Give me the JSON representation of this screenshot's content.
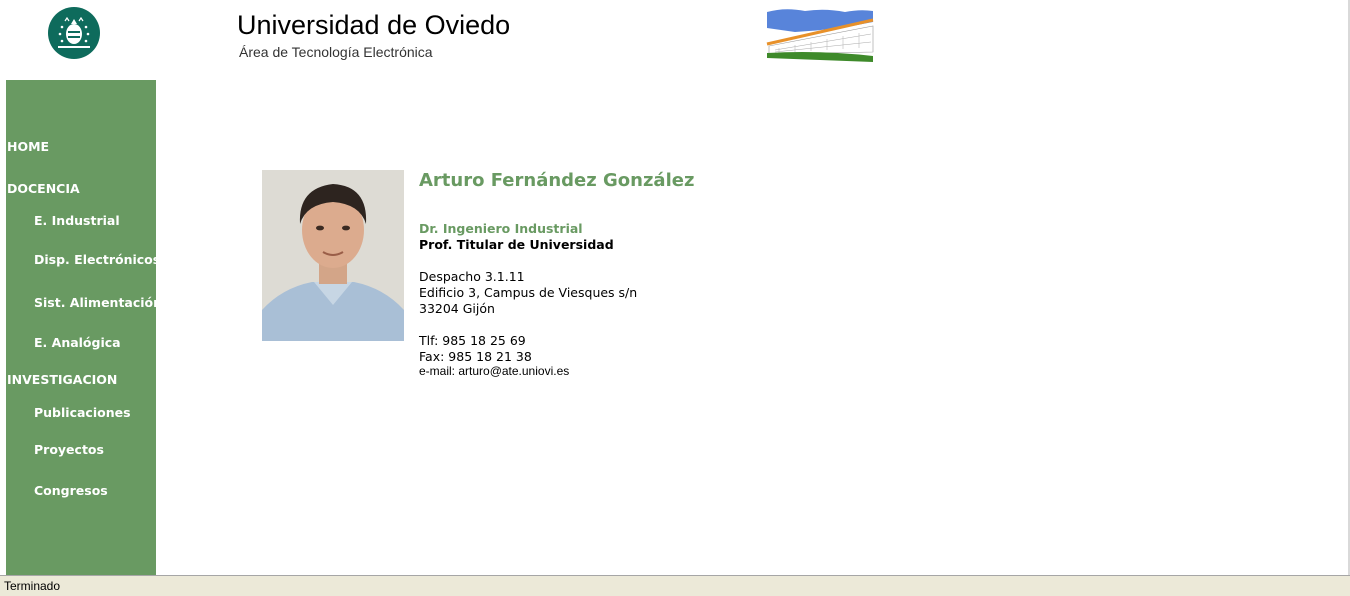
{
  "header": {
    "title": "Universidad de Oviedo",
    "subtitle": "Área de Tecnología Electrónica"
  },
  "sidebar": {
    "items": [
      {
        "label": "HOME",
        "level": "top"
      },
      {
        "label": "DOCENCIA",
        "level": "top"
      },
      {
        "label": "E. Industrial",
        "level": "sub"
      },
      {
        "label": "Disp. Electrónicos",
        "level": "sub"
      },
      {
        "label": "Sist. Alimentación",
        "level": "sub"
      },
      {
        "label": "E. Analógica",
        "level": "sub"
      },
      {
        "label": "INVESTIGACION",
        "level": "top"
      },
      {
        "label": "Publicaciones",
        "level": "sub"
      },
      {
        "label": "Proyectos",
        "level": "sub"
      },
      {
        "label": "Congresos",
        "level": "sub"
      }
    ]
  },
  "profile": {
    "name": "Arturo Fernández González",
    "degree": "Dr. Ingeniero Industrial",
    "position": "Prof. Titular de Universidad",
    "office": "Despacho 3.1.11",
    "building": "Edificio 3, Campus de Viesques s/n",
    "city": "33204 Gijón",
    "phone": "Tlf: 985 18 25 69",
    "fax": "Fax: 985 18 21 38",
    "email": "e-mail: arturo@ate.uniovi.es"
  },
  "statusbar": {
    "text": "Terminado"
  },
  "colors": {
    "sidebar_green": "#699a62",
    "logo_green": "#0e6b5c"
  }
}
